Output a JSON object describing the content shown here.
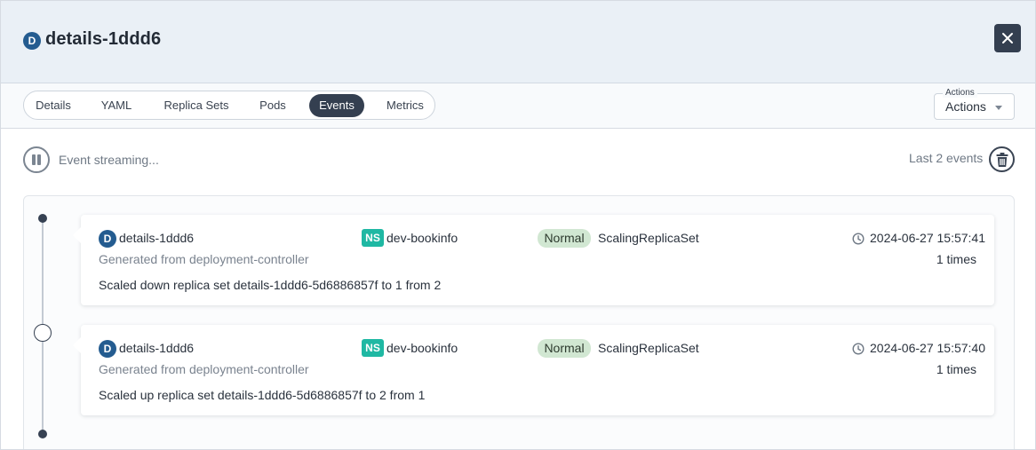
{
  "header": {
    "kind_badge": "D",
    "title": "details-1ddd6"
  },
  "tabs": [
    {
      "label": "Details",
      "active": false
    },
    {
      "label": "YAML",
      "active": false
    },
    {
      "label": "Replica Sets",
      "active": false
    },
    {
      "label": "Pods",
      "active": false
    },
    {
      "label": "Events",
      "active": true
    },
    {
      "label": "Metrics",
      "active": false
    }
  ],
  "actions": {
    "legend": "Actions",
    "value": "Actions"
  },
  "streaming": {
    "status_text": "Event streaming...",
    "count_text": "Last 2 events"
  },
  "events": [
    {
      "kind_badge": "D",
      "name": "details-1ddd6",
      "source": "Generated from deployment-controller",
      "namespace_badge": "NS",
      "namespace": "dev-bookinfo",
      "type": "Normal",
      "reason": "ScalingReplicaSet",
      "timestamp": "2024-06-27 15:57:41",
      "count": "1 times",
      "message": "Scaled down replica set details-1ddd6-5d6886857f to 1 from 2"
    },
    {
      "kind_badge": "D",
      "name": "details-1ddd6",
      "source": "Generated from deployment-controller",
      "namespace_badge": "NS",
      "namespace": "dev-bookinfo",
      "type": "Normal",
      "reason": "ScalingReplicaSet",
      "timestamp": "2024-06-27 15:57:40",
      "count": "1 times",
      "message": "Scaled up replica set details-1ddd6-5d6886857f to 2 from 1"
    }
  ],
  "colors": {
    "header_bg": "#eaf0f6",
    "dark": "#343f50",
    "kind_badge": "#245c90",
    "ns_badge": "#1fb8a3",
    "normal_badge": "#d1e7d2"
  },
  "icons": {
    "close": "close-icon",
    "pause": "pause-icon",
    "trash": "trash-icon",
    "clock": "clock-icon",
    "caret": "chevron-down-icon"
  }
}
